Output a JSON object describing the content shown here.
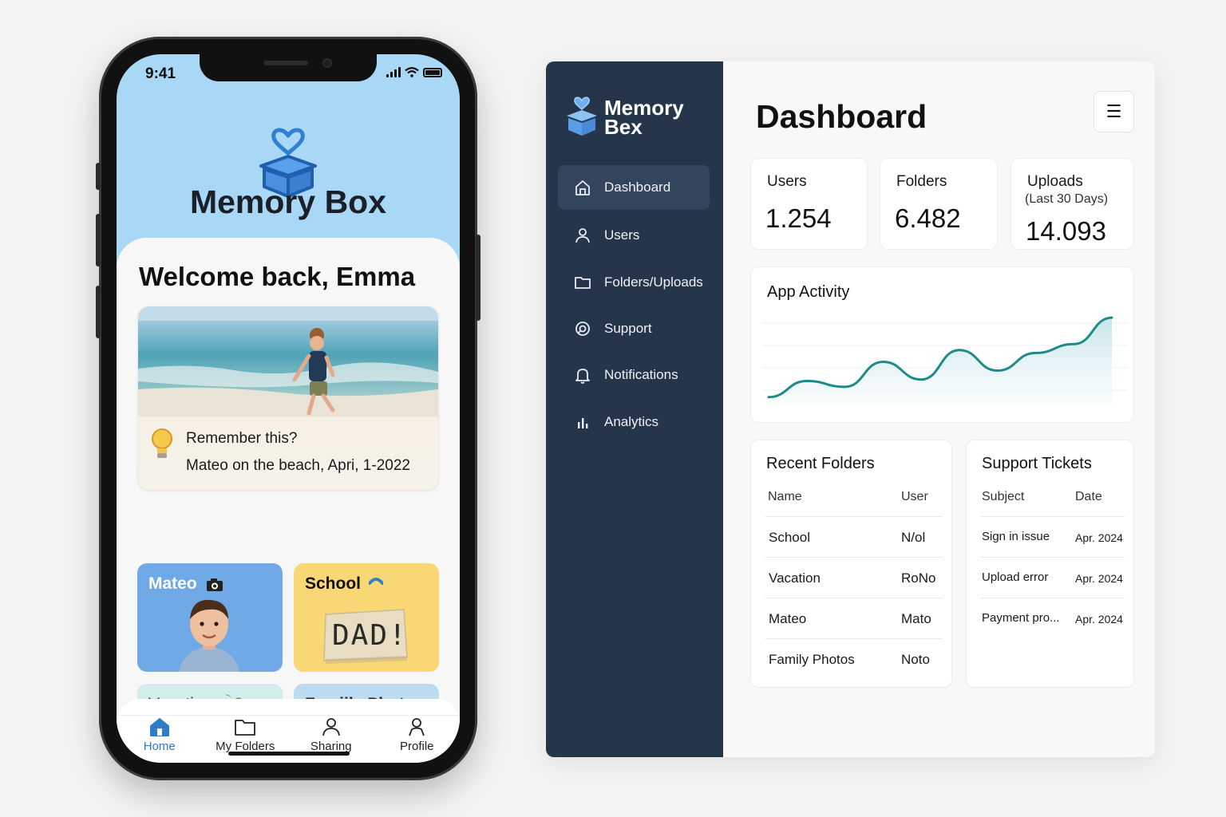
{
  "colors": {
    "sky": "#a9d8f7",
    "accent_blue": "#2e7cc7",
    "sidebar": "#25364b",
    "sidebar_active": "#33455c",
    "chart_line": "#1f8a8a",
    "tile_mateo": "#6fa9e6",
    "tile_school": "#f8d774",
    "tile_vacation": "#d3eeea"
  },
  "mobile": {
    "status": {
      "time": "9:41"
    },
    "app_title": "Memory Box",
    "welcome": "Welcome back, Emma",
    "memory": {
      "title": "Remember this?",
      "subtitle": "Mateo on the beach, Apri, 1-2022",
      "icon": "lightbulb-icon"
    },
    "folders": [
      {
        "label": "Mateo",
        "icon": "camera-icon"
      },
      {
        "label": "School",
        "icon": "telephone-icon",
        "note": "DAD!"
      },
      {
        "label": "Vacation",
        "icon": "palm-tree-icon"
      },
      {
        "label": "Famiily Photos"
      }
    ],
    "tabs": [
      {
        "label": "Home",
        "icon": "home-icon",
        "active": true
      },
      {
        "label": "My Folders",
        "icon": "folder-icon"
      },
      {
        "label": "Sharing",
        "icon": "user-icon"
      },
      {
        "label": "Profile",
        "icon": "user-icon"
      }
    ]
  },
  "admin": {
    "brand": {
      "line1": "Memory",
      "line2": "Bex"
    },
    "nav": [
      {
        "label": "Dashboard",
        "icon": "home-icon",
        "active": true
      },
      {
        "label": "Users",
        "icon": "user-icon"
      },
      {
        "label": "Folders/Uploads",
        "icon": "folder-icon"
      },
      {
        "label": "Support",
        "icon": "support-icon"
      },
      {
        "label": "Notifications",
        "icon": "bell-icon"
      },
      {
        "label": "Analytics",
        "icon": "bar-chart-icon"
      }
    ],
    "title": "Dashboard",
    "menu_icon": "☰",
    "stats": [
      {
        "label": "Users",
        "value": "1.254"
      },
      {
        "label": "Folders",
        "value": "6.482"
      },
      {
        "label": "Uploads",
        "sub": "(Last 30 Days)",
        "value": "14.093"
      }
    ],
    "activity": {
      "title": "App Activity"
    },
    "recent_folders": {
      "title": "Recent Folders",
      "columns": [
        "Name",
        "User"
      ],
      "rows": [
        [
          "School",
          "N/ol"
        ],
        [
          "Vacation",
          "RoNo"
        ],
        [
          "Mateo",
          "Mato"
        ],
        [
          "Family Photos",
          "Noto"
        ]
      ]
    },
    "support_tickets": {
      "title": "Support Tickets",
      "columns": [
        "Subject",
        "Date"
      ],
      "rows": [
        [
          "Sign in issue",
          "Apr. 2024"
        ],
        [
          "Upload error",
          "Apr. 2024"
        ],
        [
          "Payment pro...",
          "Apr. 2024"
        ]
      ]
    }
  },
  "chart_data": {
    "type": "area",
    "title": "App Activity",
    "series": [
      {
        "values": [
          10,
          32,
          24,
          58,
          34,
          74,
          46,
          70,
          82,
          118
        ]
      }
    ],
    "ylim": [
      0,
      130
    ],
    "grid": true
  }
}
